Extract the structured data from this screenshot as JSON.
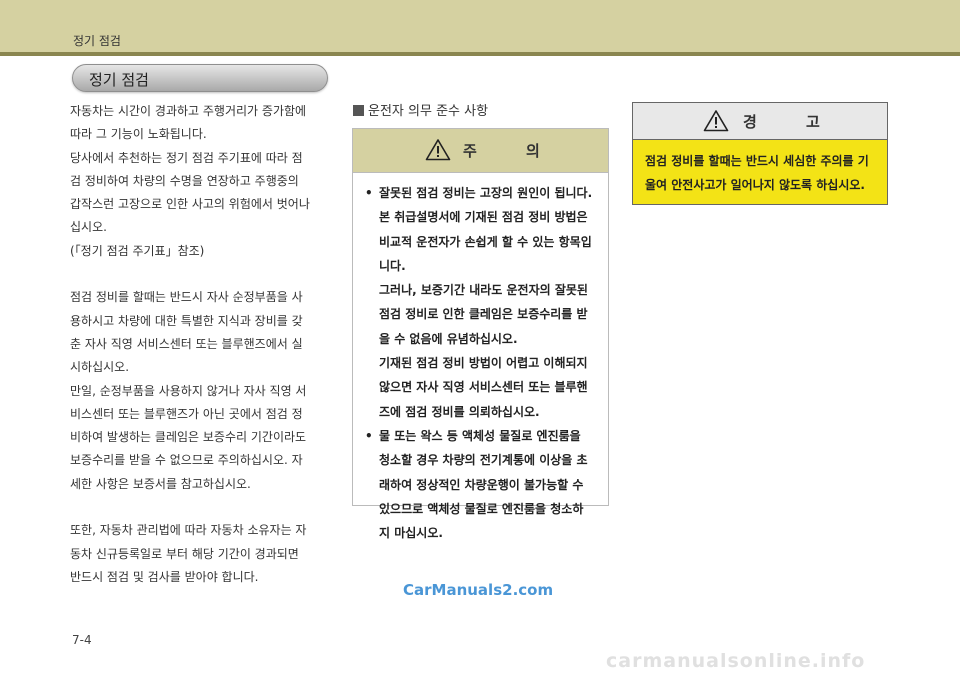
{
  "header": {
    "title": "정기 점검"
  },
  "section": {
    "title": "정기 점검"
  },
  "left_text": {
    "paragraphs": [
      [
        "자동차는 시간이 경과하고 주행거리가 증가함에",
        "따라 그 기능이 노화됩니다.",
        "당사에서 추천하는 정기 점검 주기표에 따라 점",
        "검 정비하여 차량의 수명을 연장하고 주행중의",
        "갑작스런 고장으로 인한 사고의 위험에서 벗어나",
        "십시오.",
        "(「정기 점검 주기표」참조)"
      ],
      [
        "점검 정비를 할때는 반드시 자사 순정부품을 사",
        "용하시고 차량에 대한 특별한 지식과 장비를 갖",
        "춘 자사 직영 서비스센터 또는 블루핸즈에서 실",
        "시하십시오.",
        "만일, 순정부품을 사용하지 않거나 자사 직영 서",
        "비스센터 또는 블루핸즈가 아닌 곳에서 점검 정",
        "비하여 발생하는 클레임은 보증수리 기간이라도",
        "보증수리를 받을 수 없으므로 주의하십시오. 자",
        "세한 사항은 보증서를 참고하십시오."
      ],
      [
        "또한, 자동차 관리법에 따라 자동차 소유자는 자",
        "동차 신규등록일로 부터 해당 기간이 경과되면",
        "반드시 점검 및 검사를 받아야 합니다."
      ]
    ]
  },
  "obligations": {
    "heading": "운전자 의무 준수 사항"
  },
  "caution": {
    "title": "주 의",
    "bullet": "•",
    "items": [
      [
        "잘못된 점검 정비는 고장의 원인이 됩니다.",
        "본 취급설명서에 기재된 점검 정비 방법은",
        "비교적 운전자가 손쉽게 할 수 있는 항목입",
        "니다.",
        "그러나, 보증기간 내라도 운전자의 잘못된",
        "점검 정비로 인한 클레임은 보증수리를 받",
        "을 수 없음에 유념하십시오.",
        "기재된 점검 정비 방법이 어렵고 이해되지",
        "않으면 자사 직영 서비스센터 또는 블루핸",
        "즈에 점검 정비를 의뢰하십시오."
      ],
      [
        "물 또는 왁스 등 액체성 물질로 엔진룸을",
        "청소할 경우 차량의 전기계통에 이상을 초",
        "래하여 정상적인 차량운행이 불가능할 수",
        "있으므로 액체성 물질로 엔진룸을 청소하",
        "지 마십시오."
      ]
    ]
  },
  "warning": {
    "title": "경 고",
    "lines": [
      "점검 정비를 할때는 반드시 세심한 주의를 기",
      "울여 안전사고가 일어나지 않도록 하십시오."
    ]
  },
  "watermark": "CarManuals2.com",
  "page_number": "7-4",
  "footer_watermark": "carmanualsonline.info",
  "colors": {
    "header_band": "#d5d1a1",
    "header_rule": "#8a8650",
    "warning_fill": "#f3e316",
    "watermark": "#4a96d6"
  },
  "icons": [
    "warning-triangle-icon"
  ]
}
